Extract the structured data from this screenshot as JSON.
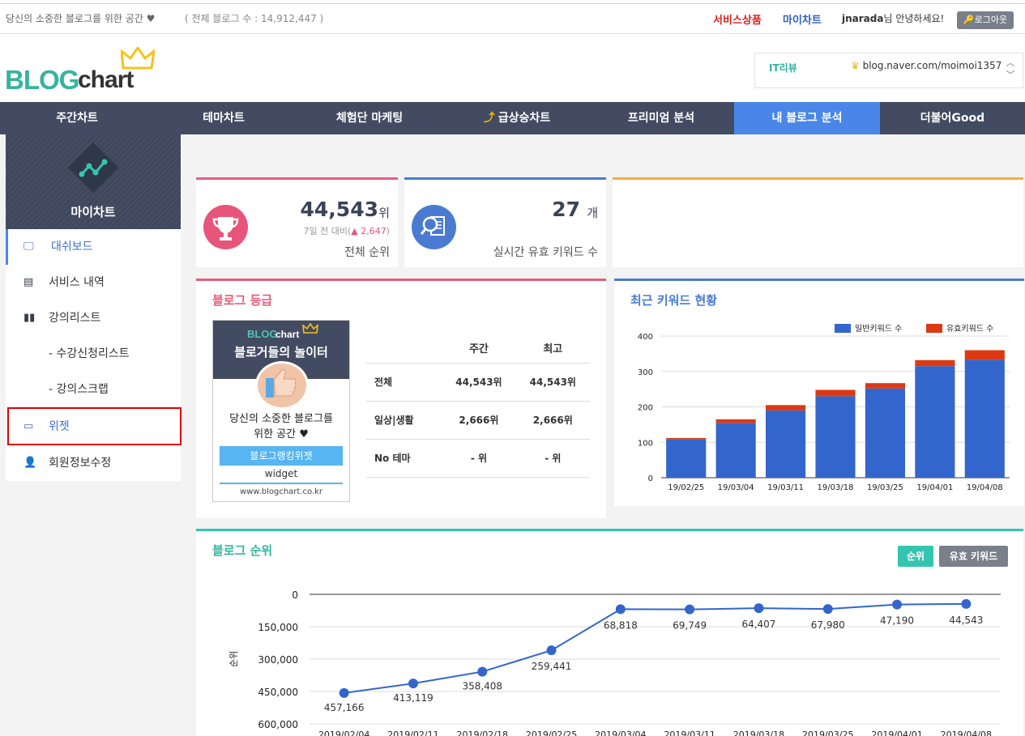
{
  "topbar": {
    "tagline": "당신의 소중한 블로그를 위한 공간 ♥",
    "total": "( 전체 블로그 수 : 14,912,447 )",
    "service": "서비스상품",
    "mychart": "마이차트",
    "user_id": "jnarada",
    "user_suffix": "님 안녕하세요!",
    "logout": "로그아웃"
  },
  "logo": {
    "blog": "BLOG",
    "chart": "chart"
  },
  "blogselect": {
    "category": "IT리뷰",
    "url": "blog.naver.com/moimoi1357"
  },
  "nav": [
    "주간차트",
    "테마차트",
    "체험단 마케팅",
    "급상승차트",
    "프리미엄 분석",
    "내 블로그 분석",
    "더불어Good"
  ],
  "sidebar": {
    "title": "마이차트",
    "items": [
      {
        "label": "대쉬보드"
      },
      {
        "label": "서비스 내역"
      },
      {
        "label": "강의리스트"
      },
      {
        "label": "- 수강신청리스트"
      },
      {
        "label": "- 강의스크랩"
      },
      {
        "label": "위젯"
      },
      {
        "label": "회원정보수정"
      }
    ]
  },
  "cards": {
    "rank": {
      "value": "44,543",
      "unit": "위",
      "delta_prefix": "7일 전 대비(",
      "delta_arrow": "▲",
      "delta_value": "2,647",
      "delta_suffix": ")",
      "label": "전체 순위"
    },
    "keywords": {
      "value": "27",
      "unit": "개",
      "label": "실시간 유효 키워드 수"
    }
  },
  "grade": {
    "title": "블로그 등급",
    "badge": {
      "logo_blog": "BLOG",
      "logo_chart": "chart",
      "headline": "블로거들의 놀이터",
      "text_line1": "당신의 소중한 블로그를",
      "text_line2": "위한 공간 ♥",
      "bar": "블로그랭킹위젯",
      "widget": "widget",
      "site": "www.blogchart.co.kr"
    },
    "table": {
      "headers": [
        "",
        "주간",
        "최고"
      ],
      "rows": [
        [
          "전체",
          "44,543위",
          "44,543위"
        ],
        [
          "일상|생활",
          "2,666위",
          "2,666위"
        ],
        [
          "No 테마",
          "- 위",
          "- 위"
        ]
      ]
    }
  },
  "keyword_chart": {
    "title": "최근 키워드 현황",
    "colors": {
      "normal": "#3366cc",
      "valid": "#dc3912"
    },
    "chart_data": {
      "type": "bar",
      "stacked": true,
      "categories": [
        "19/02/25",
        "19/03/04",
        "19/03/11",
        "19/03/18",
        "19/03/25",
        "19/04/01",
        "19/04/08"
      ],
      "series": [
        {
          "name": "일반키워드 수",
          "values": [
            108,
            155,
            190,
            230,
            252,
            315,
            333
          ]
        },
        {
          "name": "유효키워드 수",
          "values": [
            4,
            10,
            15,
            18,
            15,
            17,
            27
          ]
        }
      ],
      "ylim": [
        0,
        400
      ],
      "yticks": [
        0,
        100,
        200,
        300,
        400
      ],
      "legend": "top-right",
      "grid": true
    }
  },
  "rank_chart": {
    "title": "블로그 순위",
    "btn_rank": "순위",
    "btn_keyword": "유효 키워드",
    "color": "#3366cc",
    "chart_data": {
      "type": "line",
      "reversed_y": true,
      "x": [
        "2019/02/04",
        "2019/02/11",
        "2019/02/18",
        "2019/02/25",
        "2019/03/04",
        "2019/03/11",
        "2019/03/18",
        "2019/03/25",
        "2019/04/01",
        "2019/04/08"
      ],
      "values": [
        457166,
        413119,
        358408,
        259441,
        68818,
        69749,
        64407,
        67980,
        47190,
        44543
      ],
      "labels": [
        "457,166",
        "413,119",
        "358,408",
        "259,441",
        "68,818",
        "69,749",
        "64,407",
        "67,980",
        "47,190",
        "44,543"
      ],
      "ylabel": "순위",
      "ylim": [
        0,
        600000
      ],
      "yticks": [
        "0",
        "150,000",
        "300,000",
        "450,000",
        "600,000"
      ],
      "grid": true
    }
  }
}
